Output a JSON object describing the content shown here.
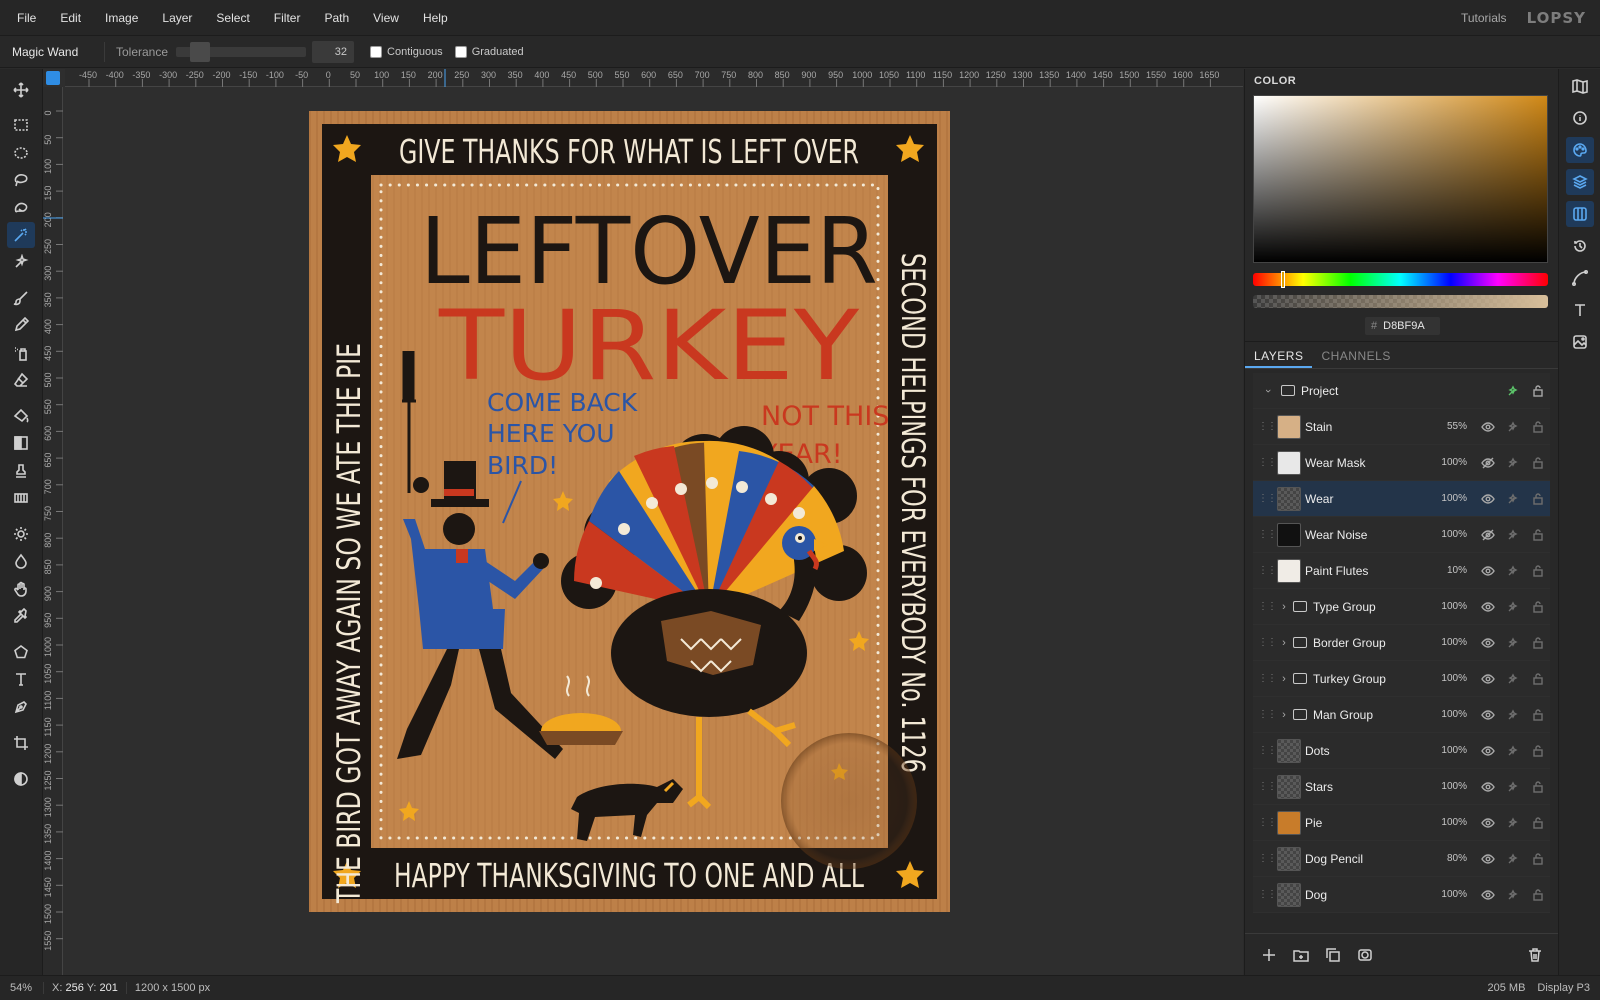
{
  "menu": {
    "items": [
      "File",
      "Edit",
      "Image",
      "Layer",
      "Select",
      "Filter",
      "Path",
      "View",
      "Help"
    ],
    "tutorials": "Tutorials",
    "logo": "LOPSY"
  },
  "options": {
    "tool": "Magic Wand",
    "tolerance_label": "Tolerance",
    "tolerance": "32",
    "contiguous": "Contiguous",
    "graduated": "Graduated"
  },
  "left_tools": [
    "move-icon",
    "rect-select-icon",
    "ellipse-select-icon",
    "lasso-icon",
    "polygon-lasso-icon",
    "magic-wand-icon",
    "quick-select-icon",
    "brush-icon",
    "pencil-icon",
    "spray-icon",
    "eraser-icon",
    "bucket-icon",
    "gradient-icon",
    "stamp-icon",
    "pattern-icon",
    "dodge-icon",
    "burn-icon",
    "hand-icon",
    "eyedropper-icon",
    "shape-icon",
    "text-icon",
    "pen-icon",
    "crop-icon",
    "contrast-icon"
  ],
  "ruler": {
    "h_labels": [
      "-450",
      "-400",
      "-350",
      "-300",
      "-250",
      "-200",
      "-150",
      "-100",
      "-50",
      "0",
      "50",
      "100",
      "150",
      "200",
      "250",
      "300",
      "350",
      "400",
      "450",
      "500",
      "550",
      "600",
      "650",
      "700",
      "750",
      "800",
      "850",
      "900",
      "950",
      "1000",
      "1050",
      "1100",
      "1150",
      "1200",
      "1250",
      "1300",
      "1350",
      "1400",
      "1450",
      "1500",
      "1550",
      "1600",
      "1650"
    ],
    "v_labels": [
      "0",
      "50",
      "100",
      "150",
      "200",
      "250",
      "300",
      "350",
      "400",
      "450",
      "500",
      "550",
      "600",
      "650",
      "700",
      "750",
      "800",
      "850",
      "900",
      "950",
      "1000",
      "1050",
      "1100",
      "1150",
      "1200",
      "1250",
      "1300",
      "1350",
      "1400",
      "1450",
      "1500",
      "1550"
    ]
  },
  "poster": {
    "top": "GIVE THANKS FOR WHAT IS LEFT OVER",
    "bottom": "HAPPY THANKSGIVING TO ONE AND ALL",
    "left": "THE BIRD GOT AWAY AGAIN SO WE ATE THE PIE",
    "right": "SECOND HELPINGS FOR EVERYBODY No. 1126",
    "title1": "LEFTOVER",
    "title2": "TURKEY",
    "say1_a": "COME BACK",
    "say1_b": "HERE YOU",
    "say1_c": "BIRD!",
    "say2_a": "NOT THIS",
    "say2_b": "YEAR!"
  },
  "color_panel": {
    "title": "COLOR",
    "hex": "D8BF9A",
    "hash": "#"
  },
  "layers_panel": {
    "tab_layers": "LAYERS",
    "tab_channels": "CHANNELS",
    "project": "Project",
    "rows": [
      {
        "name": "Stain",
        "opacity": "55%",
        "thumb": "#d6b086",
        "visible": true
      },
      {
        "name": "Wear Mask",
        "opacity": "100%",
        "thumb": "#e8e8e8",
        "visible": false
      },
      {
        "name": "Wear",
        "opacity": "100%",
        "thumb": "",
        "visible": true,
        "selected": true
      },
      {
        "name": "Wear Noise",
        "opacity": "100%",
        "thumb": "#111111",
        "visible": false
      },
      {
        "name": "Paint Flutes",
        "opacity": "10%",
        "thumb": "#f0ece6",
        "visible": true
      },
      {
        "name": "Type Group",
        "opacity": "100%",
        "group": true,
        "visible": true
      },
      {
        "name": "Border Group",
        "opacity": "100%",
        "group": true,
        "visible": true
      },
      {
        "name": "Turkey Group",
        "opacity": "100%",
        "group": true,
        "visible": true
      },
      {
        "name": "Man Group",
        "opacity": "100%",
        "group": true,
        "visible": true
      },
      {
        "name": "Dots",
        "opacity": "100%",
        "thumb": "",
        "visible": true
      },
      {
        "name": "Stars",
        "opacity": "100%",
        "thumb": "",
        "visible": true
      },
      {
        "name": "Pie",
        "opacity": "100%",
        "thumb": "#c87c2a",
        "visible": true
      },
      {
        "name": "Dog Pencil",
        "opacity": "80%",
        "thumb": "",
        "visible": true
      },
      {
        "name": "Dog",
        "opacity": "100%",
        "thumb": "",
        "visible": true
      }
    ]
  },
  "status": {
    "zoom": "54%",
    "x_label": "X:",
    "x": "256",
    "y_label": "Y:",
    "y": "201",
    "dims": "1200 x 1500 px",
    "memory": "205 MB",
    "profile": "Display P3"
  }
}
